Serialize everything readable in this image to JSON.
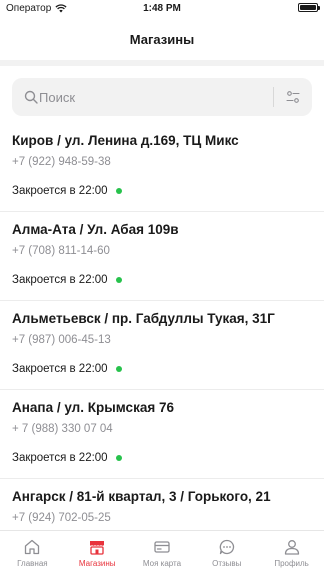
{
  "status_bar": {
    "carrier": "Оператор",
    "time": "1:48 PM"
  },
  "nav": {
    "title": "Магазины"
  },
  "search": {
    "placeholder": "Поиск"
  },
  "stores": [
    {
      "name": "Киров / ул. Ленина д.169, ТЦ Микс",
      "phone": "+7 (922) 948-59-38",
      "status": "Закроется в 22:00"
    },
    {
      "name": "Алма-Ата / Ул. Абая 109в",
      "phone": "+7 (708) 811-14-60",
      "status": "Закроется в 22:00"
    },
    {
      "name": "Альметьевск / пр. Габдуллы Тукая, 31Г",
      "phone": "+7 (987) 006-45-13",
      "status": "Закроется в 22:00"
    },
    {
      "name": "Анапа / ул. Крымская 76",
      "phone": "+ 7 (988) 330 07 04",
      "status": "Закроется в 22:00"
    },
    {
      "name": "Ангарск / 81-й квартал, 3 / Горького, 21",
      "phone": "+7 (924) 702-05-25",
      "status": ""
    }
  ],
  "tabs": [
    {
      "label": "Главная",
      "icon": "home-icon"
    },
    {
      "label": "Магазины",
      "icon": "store-icon",
      "active": true
    },
    {
      "label": "Моя карта",
      "icon": "card-icon"
    },
    {
      "label": "Отзывы",
      "icon": "chat-icon"
    },
    {
      "label": "Профиль",
      "icon": "profile-icon"
    }
  ],
  "colors": {
    "accent": "#e8333c",
    "open_status": "#27c24c",
    "secondary_text": "#8e8e93"
  }
}
